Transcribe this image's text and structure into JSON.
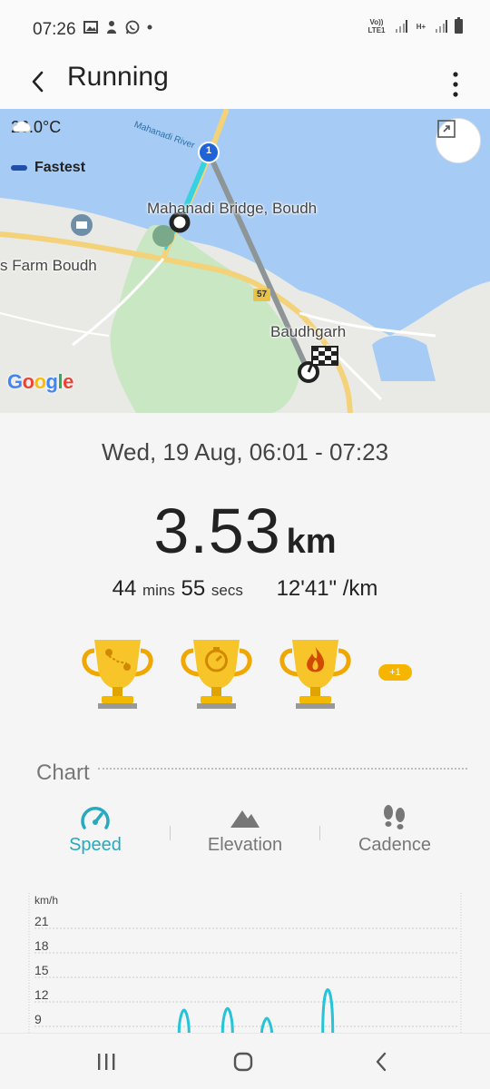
{
  "status_bar": {
    "time": "07:26",
    "network_left": "Vo)) LTE1",
    "network_right": "H+"
  },
  "app_bar": {
    "title": "Running"
  },
  "map": {
    "temperature": "26.0°C",
    "legend_label": "Fastest",
    "river_label": "Mahanadi River",
    "place_bridge": "Mahanadi Bridge, Boudh",
    "place_farm": "s Farm Boudh",
    "place_town": "Baudhgarh",
    "road_number": "57",
    "lap_marker": "1",
    "attribution": "Google",
    "route_color": "#8e9596",
    "fastest_color": "#1f4fa8"
  },
  "summary": {
    "datetime": "Wed, 19 Aug, 06:01 - 07:23",
    "distance_value": "3.53",
    "distance_unit": "km",
    "duration_mins": "44",
    "mins_label": "mins",
    "duration_secs": "55",
    "secs_label": "secs",
    "pace": "12'41\" /km",
    "extra_badges": "+1",
    "trophy_icons": [
      "route-trophy-icon",
      "stopwatch-trophy-icon",
      "flame-trophy-icon"
    ]
  },
  "chart_section": {
    "title": "Chart",
    "tabs": [
      {
        "label": "Speed",
        "icon": "speedometer-icon",
        "active": true
      },
      {
        "label": "Elevation",
        "icon": "mountain-icon",
        "active": false
      },
      {
        "label": "Cadence",
        "icon": "footprints-icon",
        "active": false
      }
    ]
  },
  "chart_data": {
    "type": "line",
    "ylabel": "km/h",
    "yticks": [
      21,
      18,
      15,
      12,
      9
    ],
    "ylim": [
      0,
      24
    ],
    "grid": true,
    "series": [
      {
        "color": "#25c4d8",
        "spikes": [
          {
            "x": 0.36,
            "peak": 11.0
          },
          {
            "x": 0.46,
            "peak": 11.2
          },
          {
            "x": 0.55,
            "peak": 10.0
          },
          {
            "x": 0.69,
            "peak": 13.5
          }
        ]
      }
    ]
  },
  "nav_bar": {
    "items": [
      "recents-icon",
      "home-icon",
      "back-icon"
    ]
  }
}
